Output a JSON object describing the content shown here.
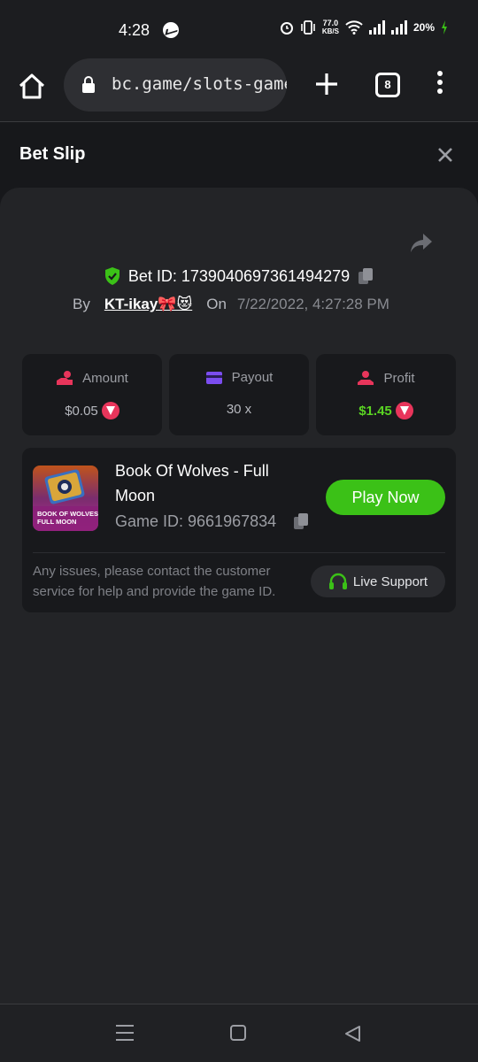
{
  "status_bar": {
    "time": "4:28",
    "speed_value": "77.0",
    "speed_unit": "KB/S",
    "battery": "20%"
  },
  "browser": {
    "url": "bc.game/slots-game/",
    "tab_count": "8"
  },
  "sheet": {
    "title": "Bet Slip"
  },
  "bet": {
    "id_text": "Bet ID: 1739040697361494279",
    "by_label": "By",
    "username": "KT-ikay🎀😻",
    "on_label": "On",
    "date": "7/22/2022, 4:27:28 PM"
  },
  "stats": [
    {
      "label": "Amount",
      "value": "$0.05",
      "icon": "coin-hand-icon"
    },
    {
      "label": "Payout",
      "value": "30 x",
      "icon": "card-icon"
    },
    {
      "label": "Profit",
      "value": "$1.45",
      "icon": "profit-hand-icon"
    }
  ],
  "game": {
    "name": "Book Of Wolves - Full Moon",
    "id_text": "Game ID: 9661967834",
    "play_label": "Play Now",
    "thumb_line1": "BOOK OF WOLVES",
    "thumb_line2": "FULL MOON"
  },
  "support": {
    "issue_text": "Any issues, please contact the customer service for help and provide the game ID.",
    "button_label": "Live Support"
  },
  "colors": {
    "accent_green": "#3bc117",
    "profit_green": "#5ad423",
    "trx_red": "#e8355b",
    "background": "#17181b",
    "card": "#232427"
  }
}
